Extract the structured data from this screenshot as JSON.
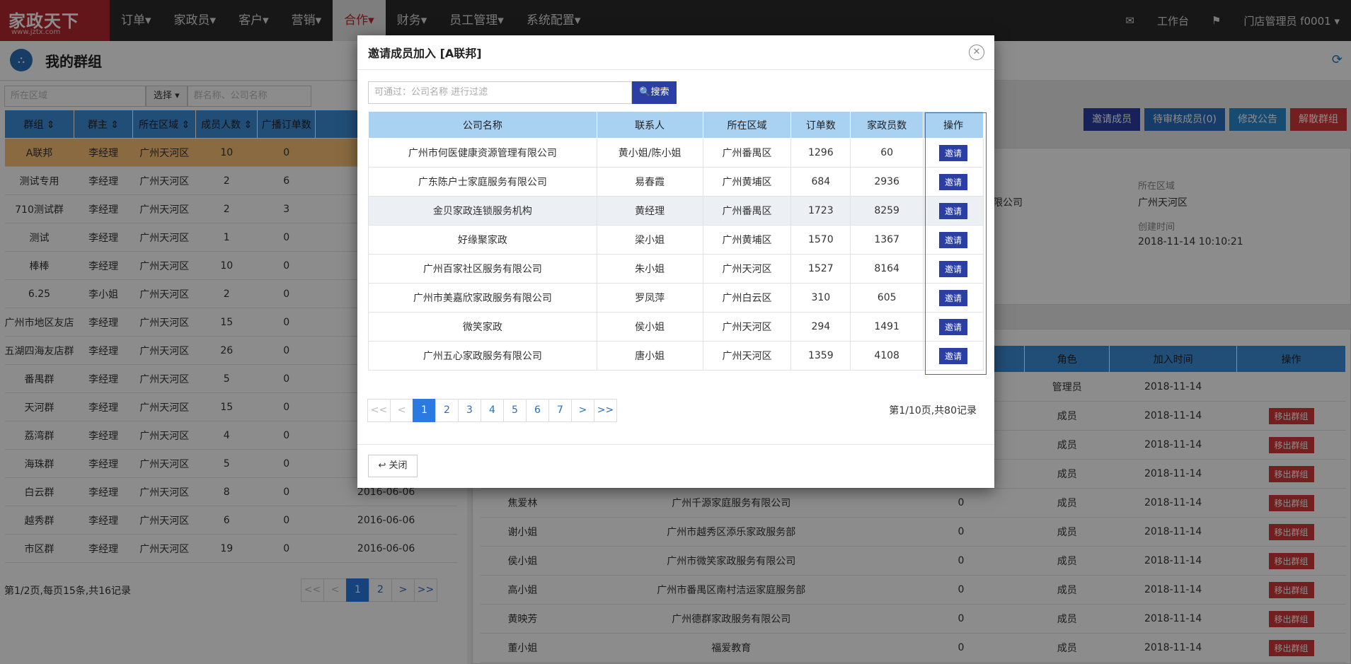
{
  "nav": {
    "logo_main": "家政天下",
    "logo_sub": "www.jztx.com",
    "items": [
      "订单▾",
      "家政员▾",
      "客户▾",
      "营销▾",
      "合作▾",
      "财务▾",
      "员工管理▾",
      "系统配置▾"
    ],
    "active_index": 4,
    "mail_icon": "✉",
    "workbench": "工作台",
    "flag_icon": "⚑",
    "user": "门店管理员 f0001 ▾"
  },
  "page": {
    "title": "我的群组",
    "refresh_icon": "⟳"
  },
  "left": {
    "filter_area_placeholder": "所在区域",
    "filter_select": "选择 ▾",
    "filter_search_placeholder": "群名称、公司名称",
    "columns": [
      "群组 ⇕",
      "群主 ⇕",
      "所在区域 ⇕",
      "成员人数 ⇕",
      "广播订单数",
      ""
    ],
    "rows": [
      [
        "A联邦",
        "李经理",
        "广州天河区",
        "10",
        "0",
        ""
      ],
      [
        "测试专用",
        "李经理",
        "广州天河区",
        "2",
        "6",
        ""
      ],
      [
        "710测试群",
        "李经理",
        "广州天河区",
        "2",
        "3",
        ""
      ],
      [
        "测试",
        "李经理",
        "广州天河区",
        "1",
        "0",
        ""
      ],
      [
        "棒棒",
        "李经理",
        "广州天河区",
        "10",
        "0",
        ""
      ],
      [
        "6.25",
        "李小姐",
        "广州天河区",
        "2",
        "0",
        ""
      ],
      [
        "广州市地区友店",
        "李经理",
        "广州天河区",
        "15",
        "0",
        ""
      ],
      [
        "五湖四海友店群",
        "李经理",
        "广州天河区",
        "26",
        "0",
        ""
      ],
      [
        "番禺群",
        "李经理",
        "广州天河区",
        "5",
        "0",
        ""
      ],
      [
        "天河群",
        "李经理",
        "广州天河区",
        "15",
        "0",
        ""
      ],
      [
        "荔湾群",
        "李经理",
        "广州天河区",
        "4",
        "0",
        ""
      ],
      [
        "海珠群",
        "李经理",
        "广州天河区",
        "5",
        "0",
        ""
      ],
      [
        "白云群",
        "李经理",
        "广州天河区",
        "8",
        "0",
        "2016-06-06"
      ],
      [
        "越秀群",
        "李经理",
        "广州天河区",
        "6",
        "0",
        "2016-06-06"
      ],
      [
        "市区群",
        "李经理",
        "广州天河区",
        "19",
        "0",
        "2016-06-06"
      ]
    ],
    "pager_info": "第1/2页,每页15条,共16记录",
    "pager": [
      "<<",
      "<",
      "1",
      "2",
      ">",
      ">>"
    ]
  },
  "right": {
    "buttons": [
      "邀请成员",
      "待审核成员(0)",
      "修改公告",
      "解散群组"
    ],
    "button_colors": [
      "#2a3ea4",
      "#2a6dbf",
      "#2a8ad0",
      "#d23a3a"
    ],
    "info_company_tail": "限公司",
    "area_label": "所在区域",
    "area_value": "广州天河区",
    "created_label": "创建时间",
    "created_value": "2018-11-14 10:10:21",
    "member_columns": [
      "",
      "",
      "",
      "角色",
      "加入时间",
      "操作"
    ],
    "members": [
      [
        "",
        "",
        "",
        "管理员",
        "2018-11-14",
        ""
      ],
      [
        "",
        "",
        "",
        "成员",
        "2018-11-14",
        "移出群组"
      ],
      [
        "",
        "",
        "",
        "成员",
        "2018-11-14",
        "移出群组"
      ],
      [
        "",
        "",
        "",
        "成员",
        "2018-11-14",
        "移出群组"
      ],
      [
        "焦爱林",
        "广州千源家庭服务有限公司",
        "0",
        "成员",
        "2018-11-14",
        "移出群组"
      ],
      [
        "谢小姐",
        "广州市越秀区添乐家政服务部",
        "0",
        "成员",
        "2018-11-14",
        "移出群组"
      ],
      [
        "侯小姐",
        "广州市微笑家政服务有限公司",
        "0",
        "成员",
        "2018-11-14",
        "移出群组"
      ],
      [
        "高小姐",
        "广州市番禺区南村洁运家庭服务部",
        "0",
        "成员",
        "2018-11-14",
        "移出群组"
      ],
      [
        "黄映芳",
        "广州德群家政服务有限公司",
        "0",
        "成员",
        "2018-11-14",
        "移出群组"
      ],
      [
        "董小姐",
        "福爱教育",
        "0",
        "成员",
        "2018-11-14",
        "移出群组"
      ]
    ]
  },
  "modal": {
    "title": "邀请成员加入 [A联邦]",
    "close_icon": "✕",
    "search_placeholder": "可通过：公司名称 进行过滤",
    "search_button": "🔍搜索",
    "columns": [
      "公司名称",
      "联系人",
      "所在区域",
      "订单数",
      "家政员数",
      "操作"
    ],
    "rows": [
      [
        "广州市何医健康资源管理有限公司",
        "黄小姐/陈小姐",
        "广州番禺区",
        "1296",
        "60",
        "邀请"
      ],
      [
        "广东陈户士家庭服务有限公司",
        "易春霞",
        "广州黄埔区",
        "684",
        "2936",
        "邀请"
      ],
      [
        "金贝家政连锁服务机构",
        "黄经理",
        "广州番禺区",
        "1723",
        "8259",
        "邀请"
      ],
      [
        "好缘聚家政",
        "梁小姐",
        "广州黄埔区",
        "1570",
        "1367",
        "邀请"
      ],
      [
        "广州百家社区服务有限公司",
        "朱小姐",
        "广州天河区",
        "1527",
        "8164",
        "邀请"
      ],
      [
        "广州市美嘉欣家政服务有限公司",
        "罗凤萍",
        "广州白云区",
        "310",
        "605",
        "邀请"
      ],
      [
        "微笑家政",
        "侯小姐",
        "广州天河区",
        "294",
        "1491",
        "邀请"
      ],
      [
        "广州五心家政服务有限公司",
        "唐小姐",
        "广州天河区",
        "1359",
        "4108",
        "邀请"
      ]
    ],
    "pager": [
      "<<",
      "<",
      "1",
      "2",
      "3",
      "4",
      "5",
      "6",
      "7",
      ">",
      ">>"
    ],
    "pager_info": "第1/10页,共80记录",
    "close_button": "↩ 关闭"
  }
}
